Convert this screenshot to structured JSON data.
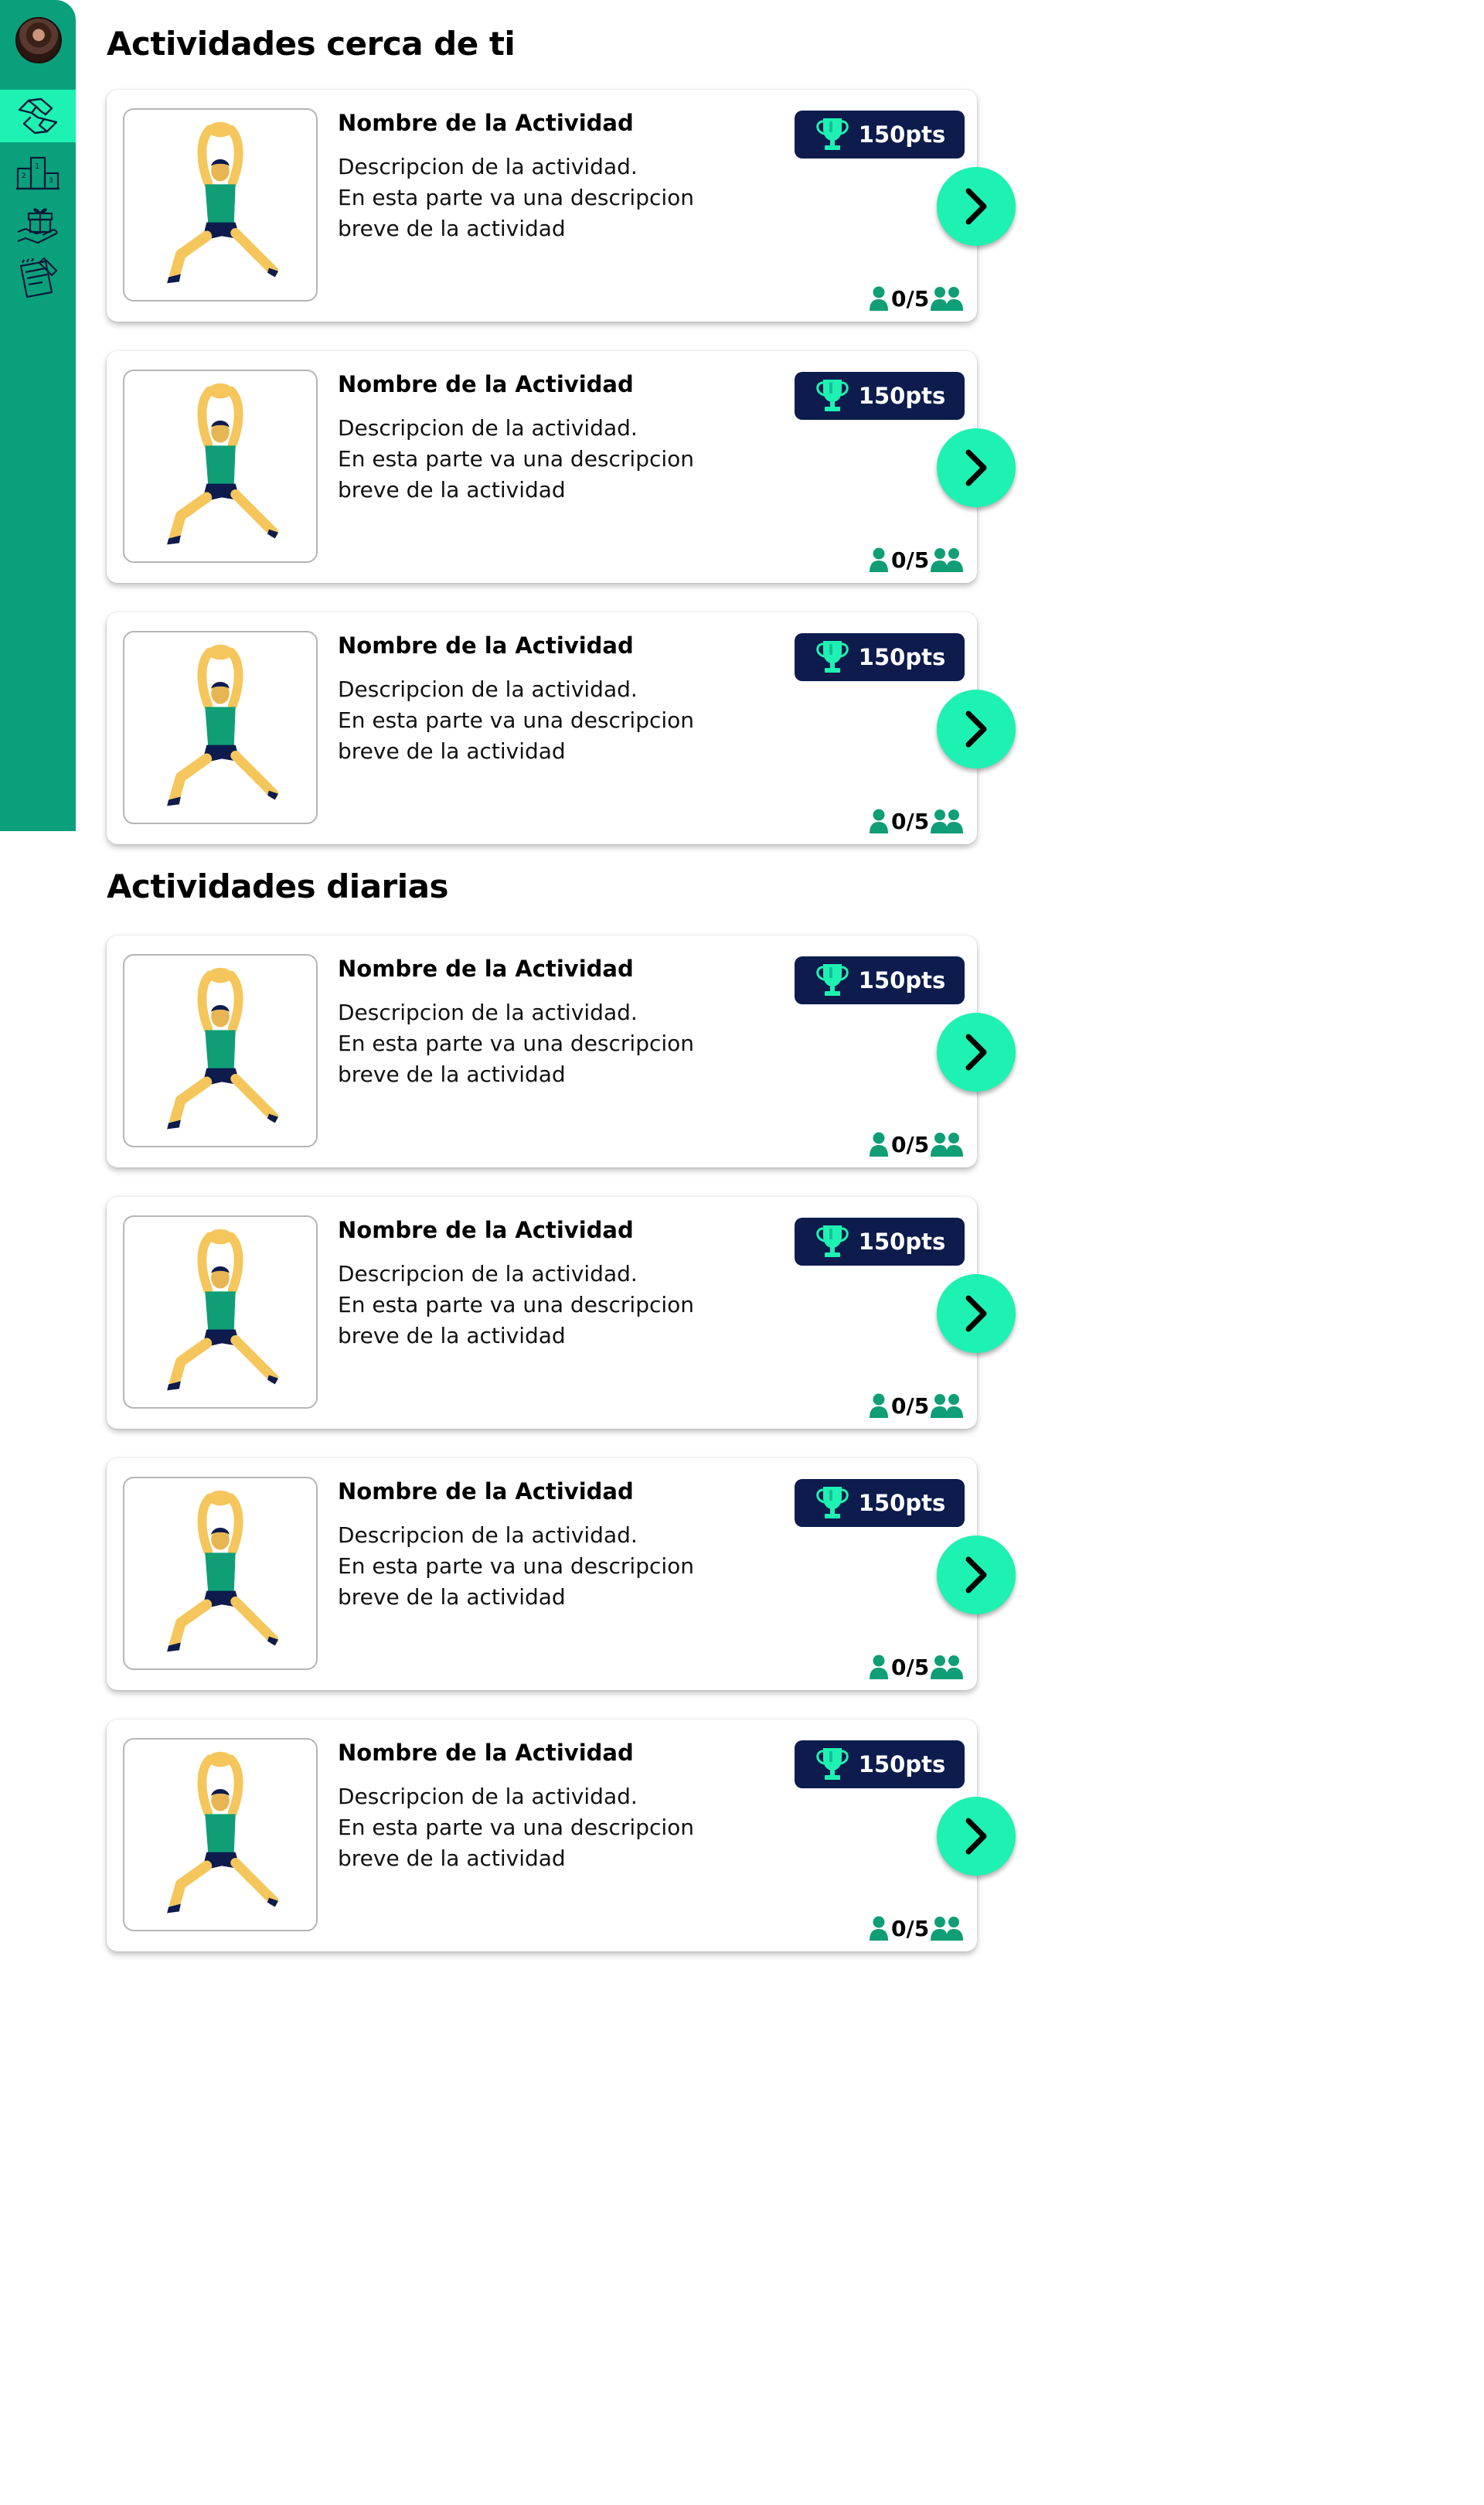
{
  "sidebar": {
    "items": [
      {
        "name": "activities",
        "icon": "hands-together-icon",
        "active": true
      },
      {
        "name": "ranking",
        "icon": "podium-icon",
        "active": false
      },
      {
        "name": "rewards",
        "icon": "gift-hand-icon",
        "active": false
      },
      {
        "name": "notes",
        "icon": "notebook-pencil-icon",
        "active": false
      }
    ]
  },
  "colors": {
    "sidebar": "#0aa07b",
    "accent": "#1df2b2",
    "badge": "#0d1b4d",
    "icon_green": "#0f9e76"
  },
  "sections": [
    {
      "title": "Actividades cerca de ti",
      "cards": [
        {
          "title": "Nombre de la Actividad",
          "desc": [
            "Descripcion de la actividad.",
            "En esta parte va una descripcion",
            "breve de la actividad"
          ],
          "points": "150pts",
          "participants": "0/5"
        },
        {
          "title": "Nombre de la Actividad",
          "desc": [
            "Descripcion de la actividad.",
            "En esta parte va una descripcion",
            "breve de la actividad"
          ],
          "points": "150pts",
          "participants": "0/5"
        },
        {
          "title": "Nombre de la Actividad",
          "desc": [
            "Descripcion de la actividad.",
            "En esta parte va una descripcion",
            "breve de la actividad"
          ],
          "points": "150pts",
          "participants": "0/5"
        }
      ]
    },
    {
      "title": "Actividades diarias",
      "cards": [
        {
          "title": "Nombre de la Actividad",
          "desc": [
            "Descripcion de la actividad.",
            "En esta parte va una descripcion",
            "breve de la actividad"
          ],
          "points": "150pts",
          "participants": "0/5"
        },
        {
          "title": "Nombre de la Actividad",
          "desc": [
            "Descripcion de la actividad.",
            "En esta parte va una descripcion",
            "breve de la actividad"
          ],
          "points": "150pts",
          "participants": "0/5"
        },
        {
          "title": "Nombre de la Actividad",
          "desc": [
            "Descripcion de la actividad.",
            "En esta parte va una descripcion",
            "breve de la actividad"
          ],
          "points": "150pts",
          "participants": "0/5"
        },
        {
          "title": "Nombre de la Actividad",
          "desc": [
            "Descripcion de la actividad.",
            "En esta parte va una descripcion",
            "breve de la actividad"
          ],
          "points": "150pts",
          "participants": "0/5"
        }
      ]
    }
  ]
}
